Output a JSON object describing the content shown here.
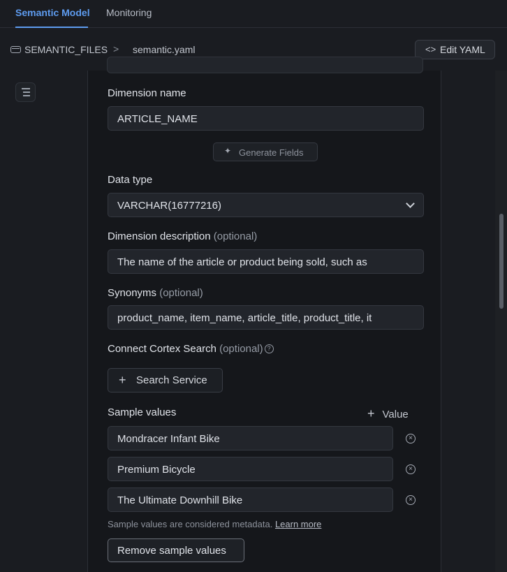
{
  "tabs": [
    {
      "label": "Semantic Model",
      "active": true
    },
    {
      "label": "Monitoring",
      "active": false
    }
  ],
  "breadcrumb": {
    "root": "SEMANTIC_FILES",
    "separator": ">",
    "file": "semantic.yaml",
    "root_icon": "database-icon"
  },
  "toolbar": {
    "edit_yaml_label": "Edit YAML",
    "edit_yaml_icon": "code-icon"
  },
  "outline_icon": "outline-list-icon",
  "form": {
    "dimension_name": {
      "label": "Dimension name",
      "value": "ARTICLE_NAME"
    },
    "generate_fields_label": "Generate Fields",
    "data_type": {
      "label": "Data type",
      "value": "VARCHAR(16777216)"
    },
    "description": {
      "label": "Dimension description",
      "optional": "(optional)",
      "value": "The name of the article or product being sold, such as"
    },
    "synonyms": {
      "label": "Synonyms",
      "optional": "(optional)",
      "value": "product_name, item_name, article_title, product_title, it"
    },
    "cortex": {
      "label": "Connect Cortex Search",
      "optional": "(optional)",
      "help": "?",
      "button_label": "Search Service"
    },
    "sample_values": {
      "label": "Sample values",
      "add_label": "Value",
      "items": [
        "Mondracer Infant Bike",
        "Premium Bicycle",
        "The Ultimate Downhill Bike"
      ],
      "note": "Sample values are considered metadata.",
      "learn_more": "Learn more",
      "remove_label": "Remove sample values"
    }
  },
  "colors": {
    "accent": "#5e9cf0",
    "background": "#1a1c21",
    "panel": "#15171b"
  }
}
